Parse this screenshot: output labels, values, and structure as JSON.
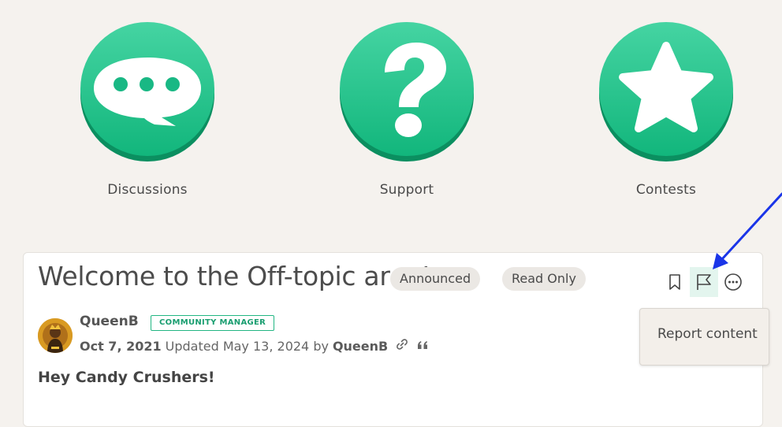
{
  "categories": [
    {
      "label": "Discussions",
      "icon": "speech-bubble-icon"
    },
    {
      "label": "Support",
      "icon": "question-mark-icon"
    },
    {
      "label": "Contests",
      "icon": "star-icon"
    }
  ],
  "topic": {
    "title": "Welcome to the Off-topic area!",
    "tags": [
      "Announced",
      "Read Only"
    ],
    "actions": {
      "bookmark_icon": "bookmark-icon",
      "flag_icon": "flag-icon",
      "more_icon": "more-options-icon"
    }
  },
  "post": {
    "author": "QueenB",
    "role_badge": "COMMUNITY MANAGER",
    "date": "Oct 7, 2021",
    "updated_text": "Updated May 13, 2024 by",
    "updated_by": "QueenB",
    "greeting": "Hey Candy Crushers!"
  },
  "tooltip": {
    "text": "Report content"
  },
  "colors": {
    "accent_green": "#1fbf86",
    "background": "#f5f2ee",
    "annotation_arrow": "#1a35e8"
  }
}
